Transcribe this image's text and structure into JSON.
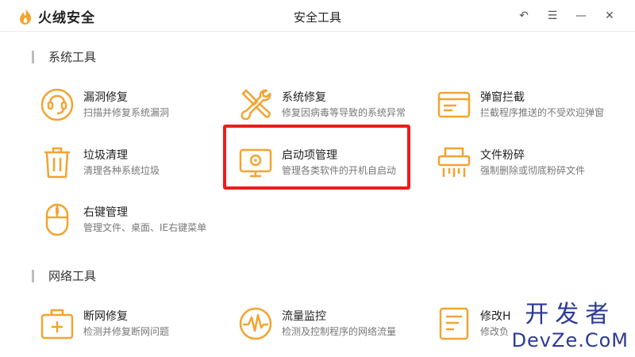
{
  "app": {
    "brand": "火绒安全",
    "window_title": "安全工具",
    "accent_color": "#f2a431",
    "highlight_color": "#ee1c1c",
    "controls": [
      {
        "icon": "back-icon",
        "glyph": "↶"
      },
      {
        "icon": "menu-icon",
        "glyph": "☰"
      },
      {
        "icon": "minimize-icon",
        "glyph": "—"
      },
      {
        "icon": "close-icon",
        "glyph": "✕"
      }
    ]
  },
  "sections": {
    "system": {
      "title": "系统工具",
      "tools": {
        "leak_repair": {
          "name": "漏洞修复",
          "desc": "扫描并修复系统漏洞",
          "icon": "shield-scan-icon"
        },
        "system_repair": {
          "name": "系统修复",
          "desc": "修复因病毒等导致的系统异常",
          "icon": "wrench-screwdriver-icon"
        },
        "popup_block": {
          "name": "弹窗拦截",
          "desc": "拦截程序推送的不受欢迎弹窗",
          "icon": "browser-window-icon"
        },
        "junk_clean": {
          "name": "垃圾清理",
          "desc": "清理各种系统垃圾",
          "icon": "trash-icon"
        },
        "startup_manage": {
          "name": "启动项管理",
          "desc": "管理各类软件的开机自启动",
          "icon": "monitor-power-icon"
        },
        "file_shred": {
          "name": "文件粉碎",
          "desc": "强制删除或彻底粉碎文件",
          "icon": "shredder-icon"
        },
        "right_click": {
          "name": "右键管理",
          "desc": "管理文件、桌面、IE右键菜单",
          "icon": "mouse-icon"
        }
      }
    },
    "network": {
      "title": "网络工具",
      "tools": {
        "net_repair": {
          "name": "断网修复",
          "desc": "检测并修复断网问题",
          "icon": "medkit-icon"
        },
        "traffic_monitor": {
          "name": "流量监控",
          "desc": "检测及控制程序的网络流量",
          "icon": "pulse-icon"
        },
        "hosts_edit": {
          "name": "修改H",
          "desc": "修改负",
          "icon": "document-edit-icon"
        }
      }
    }
  },
  "watermark": {
    "cn": "开发者",
    "en": "DevZe.CoM"
  }
}
